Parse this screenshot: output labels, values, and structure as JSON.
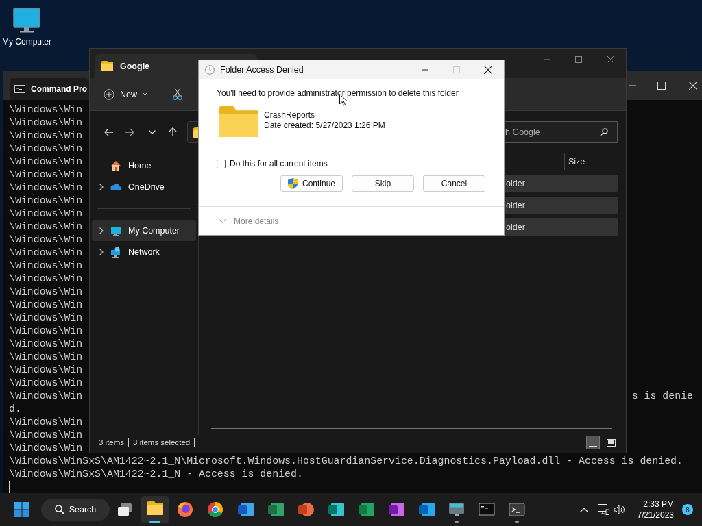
{
  "desktop_icons": [
    {
      "label": "My Computer"
    }
  ],
  "command_prompt": {
    "tab_title": "Command Pro",
    "lines": [
      {
        "text": "\\Windows\\Win"
      },
      {
        "text": "\\Windows\\Win"
      },
      {
        "text": "\\Windows\\Win"
      },
      {
        "text": "\\Windows\\Win"
      },
      {
        "text": "\\Windows\\Win"
      },
      {
        "text": "\\Windows\\Win"
      },
      {
        "text": "\\Windows\\Win"
      },
      {
        "text": "\\Windows\\Win"
      },
      {
        "text": "\\Windows\\Win"
      },
      {
        "text": "\\Windows\\Win"
      },
      {
        "text": "\\Windows\\Win"
      },
      {
        "text": "\\Windows\\Win"
      },
      {
        "text": "\\Windows\\Win"
      },
      {
        "text": "\\Windows\\Win"
      },
      {
        "text": "\\Windows\\Win"
      },
      {
        "text": "\\Windows\\Win"
      },
      {
        "text": "\\Windows\\Win"
      },
      {
        "text": "\\Windows\\Win"
      },
      {
        "text": "\\Windows\\Win"
      },
      {
        "text": "\\Windows\\Win"
      },
      {
        "text": "\\Windows\\Win"
      },
      {
        "text": "\\Windows\\Win"
      },
      {
        "text": "\\Windows\\Win",
        "tail": "s is denie"
      },
      {
        "text": "d."
      },
      {
        "text": "\\Windows\\Win"
      },
      {
        "text": "\\Windows\\Win"
      },
      {
        "text": "\\Windows\\Win"
      },
      {
        "text": "\\Windows\\WinSxS\\AM1422~2.1_N\\Microsoft.Windows.HostGuardianService.Diagnostics.Payload.dll - Access is denied."
      },
      {
        "text": "\\Windows\\WinSxS\\AM1422~2.1_N - Access is denied."
      }
    ]
  },
  "explorer": {
    "tab_title": "Google",
    "new_label": "New",
    "search": {
      "placeholder": "h Google"
    },
    "sidebar": {
      "items": [
        {
          "label": "Home",
          "kind": "home",
          "expander": false,
          "selected": false
        },
        {
          "label": "OneDrive",
          "kind": "cloud",
          "expander": true,
          "selected": false
        },
        {
          "label": "My Computer",
          "kind": "computer",
          "expander": true,
          "selected": true,
          "separator_before": true
        },
        {
          "label": "Network",
          "kind": "network",
          "expander": true,
          "selected": false
        }
      ]
    },
    "columns": [
      "Size"
    ],
    "rows": [
      {
        "type": "older",
        "selected": true
      },
      {
        "type": "older",
        "selected": true
      },
      {
        "type": "older",
        "selected": true
      }
    ],
    "status_bar": {
      "count": "3 items",
      "selection": "3 items selected"
    },
    "views": [
      {
        "kind": "details",
        "selected": true
      },
      {
        "kind": "tiles",
        "selected": false
      }
    ]
  },
  "dialog": {
    "title": "Folder Access Denied",
    "message": "You'll need to provide administrator permission to delete this folder",
    "item": {
      "name": "CrashReports",
      "date": "Date created: 5/27/2023 1:26 PM"
    },
    "checkbox": {
      "label": "Do this for all current items",
      "checked": false
    },
    "buttons": [
      {
        "label": "Continue",
        "shield": true
      },
      {
        "label": "Skip",
        "shield": false
      },
      {
        "label": "Cancel",
        "shield": false
      }
    ],
    "more_details": "More details"
  },
  "taskbar": {
    "search_label": "Search",
    "apps": [
      {
        "kind": "taskview",
        "running": false,
        "active": false
      },
      {
        "kind": "files",
        "running": true,
        "active": true
      },
      {
        "kind": "fox",
        "running": false,
        "active": false
      },
      {
        "kind": "wheel",
        "running": false,
        "active": false
      },
      {
        "kind": "word",
        "running": false,
        "active": false
      },
      {
        "kind": "project",
        "running": false,
        "active": false
      },
      {
        "kind": "slides",
        "running": false,
        "active": false
      },
      {
        "kind": "publisher",
        "running": false,
        "active": false
      },
      {
        "kind": "excel",
        "running": false,
        "active": false
      },
      {
        "kind": "onenote",
        "running": false,
        "active": false
      },
      {
        "kind": "outlook",
        "running": false,
        "active": false
      },
      {
        "kind": "keyboard",
        "running": true,
        "active": false
      },
      {
        "kind": "console",
        "running": false,
        "active": false
      },
      {
        "kind": "terminal",
        "running": true,
        "active": false
      }
    ],
    "clock": {
      "time": "2:33 PM",
      "date": "7/21/2023"
    },
    "notification_count": "8"
  }
}
